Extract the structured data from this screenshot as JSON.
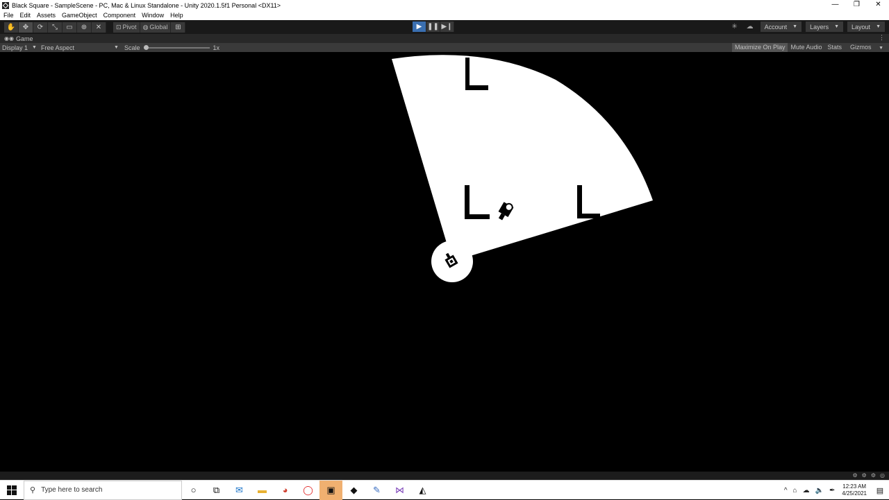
{
  "window": {
    "title": "Black Square - SampleScene - PC, Mac & Linux Standalone - Unity 2020.1.5f1 Personal <DX11>",
    "controls": [
      "—",
      "❐",
      "✕"
    ]
  },
  "menu": [
    "File",
    "Edit",
    "Assets",
    "GameObject",
    "Component",
    "Window",
    "Help"
  ],
  "toolbar": {
    "tools": [
      {
        "name": "hand-tool",
        "glyph": "✋"
      },
      {
        "name": "move-tool",
        "glyph": "✥"
      },
      {
        "name": "rotate-tool",
        "glyph": "⟳"
      },
      {
        "name": "scale-tool",
        "glyph": "⤡"
      },
      {
        "name": "rect-tool",
        "glyph": "▭"
      },
      {
        "name": "transform-tool",
        "glyph": "⊕"
      },
      {
        "name": "custom-tool",
        "glyph": "✕"
      }
    ],
    "pivot_label": "Pivot",
    "global_label": "Global",
    "account_label": "Account",
    "layers_label": "Layers",
    "layout_label": "Layout"
  },
  "tab": {
    "label": "Game"
  },
  "gamebar": {
    "display": "Display 1",
    "aspect": "Free Aspect",
    "scale_label": "Scale",
    "scale_value": "1x",
    "maximize": "Maximize On Play",
    "mute": "Mute Audio",
    "stats": "Stats",
    "gizmos": "Gizmos"
  },
  "taskbar": {
    "search_placeholder": "Type here to search",
    "time": "12:23 AM",
    "date": "4/25/2021"
  }
}
